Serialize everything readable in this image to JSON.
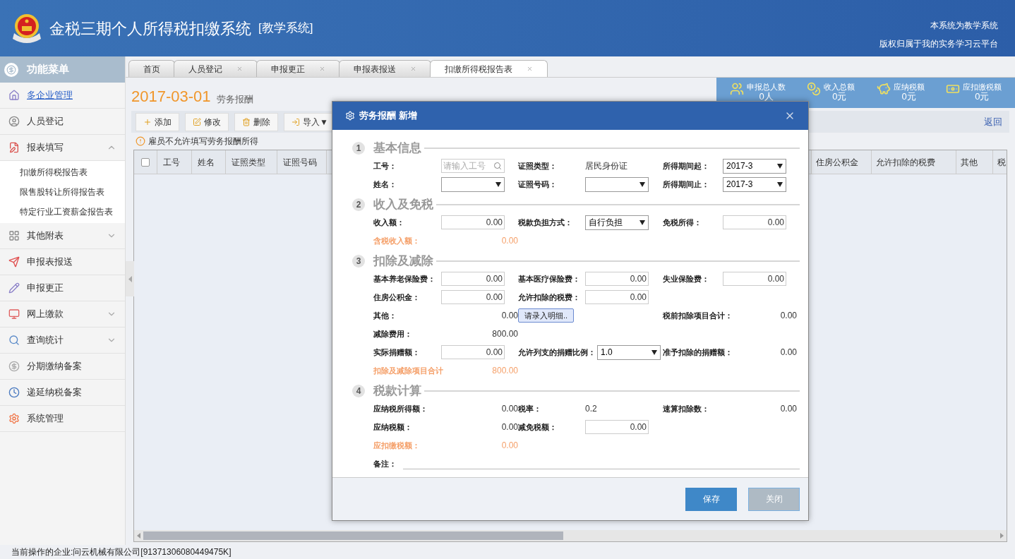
{
  "header": {
    "title": "金税三期个人所得税扣缴系统",
    "tag": "[教学系统]",
    "notes": [
      "本系统为教学系统",
      "版权归属于我的实务学习云平台"
    ]
  },
  "sidebar": {
    "title": "功能菜单",
    "items": [
      {
        "label": "多企业管理",
        "selected": true
      },
      {
        "label": "人员登记",
        "selected": false
      },
      {
        "label": "报表填写",
        "selected": false,
        "expanded": true,
        "children": [
          {
            "label": "扣缴所得税报告表"
          },
          {
            "label": "限售股转让所得报告表"
          },
          {
            "label": "特定行业工资薪金报告表"
          }
        ]
      },
      {
        "label": "其他附表",
        "selected": false,
        "expanded": false
      },
      {
        "label": "申报表报送",
        "selected": false
      },
      {
        "label": "申报更正",
        "selected": false
      },
      {
        "label": "网上缴款",
        "selected": false,
        "expanded": false
      },
      {
        "label": "查询统计",
        "selected": false,
        "expanded": false
      },
      {
        "label": "分期缴纳备案",
        "selected": false
      },
      {
        "label": "递延纳税备案",
        "selected": false
      },
      {
        "label": "系统管理",
        "selected": false
      }
    ]
  },
  "tabs": [
    {
      "label": "首页",
      "selected": false,
      "closable": false
    },
    {
      "label": "人员登记",
      "selected": false,
      "closable": true
    },
    {
      "label": "申报更正",
      "selected": false,
      "closable": true
    },
    {
      "label": "申报表报送",
      "selected": false,
      "closable": true
    },
    {
      "label": "扣缴所得税报告表",
      "selected": true,
      "closable": true
    }
  ],
  "page": {
    "date": "2017-03-01",
    "subtitle": "劳务报酬",
    "back_link": "返回",
    "notice": "雇员不允许填写劳务报酬所得"
  },
  "stats": [
    {
      "label": "申报总人数",
      "value": "0人"
    },
    {
      "label": "收入总额",
      "value": "0元"
    },
    {
      "label": "应纳税额",
      "value": "0元"
    },
    {
      "label": "应扣缴税额",
      "value": "0元"
    }
  ],
  "toolbar": [
    {
      "label": "添加"
    },
    {
      "label": "修改"
    },
    {
      "label": "删除"
    },
    {
      "label": "导入▼"
    }
  ],
  "table": {
    "select_all": {
      "checked": false
    },
    "columns_left": [
      "工号",
      "姓名",
      "证照类型",
      "证照号码"
    ],
    "columns_right": [
      "住房公积金",
      "允许扣除的税费",
      "其他",
      "税"
    ]
  },
  "dialog": {
    "title": "劳务报酬 新增",
    "sections": [
      {
        "number": "1",
        "title": "基本信息",
        "rows": [
          [
            {
              "label": "工号：",
              "kind": "search",
              "placeholder": "请输入工号"
            },
            {
              "label": "证照类型：",
              "kind": "text-left",
              "value": "居民身份证"
            },
            {
              "label": "所得期间起：",
              "kind": "select",
              "value": "2017-3"
            }
          ],
          [
            {
              "label": "姓名：",
              "kind": "select"
            },
            {
              "label": "证照号码：",
              "kind": "select"
            },
            {
              "label": "所得期间止：",
              "kind": "select",
              "value": "2017-3"
            }
          ]
        ]
      },
      {
        "number": "2",
        "title": "收入及免税",
        "rows": [
          [
            {
              "label": "收入额：",
              "kind": "input",
              "value": "0.00"
            },
            {
              "label": "税款负担方式：",
              "kind": "select",
              "value": "自行负担"
            },
            {
              "label": "免税所得：",
              "kind": "input",
              "value": "0.00"
            }
          ],
          [
            {
              "label": "含税收入额：",
              "kind": "text",
              "value": "0.00",
              "accent": true
            }
          ]
        ]
      },
      {
        "number": "3",
        "title": "扣除及减除",
        "rows": [
          [
            {
              "label": "基本养老保险费：",
              "kind": "input",
              "value": "0.00"
            },
            {
              "label": "基本医疗保险费：",
              "kind": "input",
              "value": "0.00"
            },
            {
              "label": "失业保险费：",
              "kind": "input",
              "value": "0.00"
            }
          ],
          [
            {
              "label": "住房公积金：",
              "kind": "input",
              "value": "0.00"
            },
            {
              "label": "允许扣除的税费：",
              "kind": "input",
              "value": "0.00"
            }
          ],
          [
            {
              "label": "其他：",
              "kind": "text",
              "value": "0.00"
            },
            {
              "kind": "button",
              "value": "请录入明细.."
            },
            {
              "label": "税前扣除项目合计：",
              "kind": "text",
              "value": "0.00"
            }
          ],
          [
            {
              "label": "减除费用：",
              "kind": "text",
              "value": "800.00"
            }
          ],
          [
            {
              "label": "实际捐赠额：",
              "kind": "input",
              "value": "0.00"
            },
            {
              "label": "允许列支的捐赠比例：",
              "kind": "select",
              "value": "1.0"
            },
            {
              "label": "准予扣除的捐赠额：",
              "kind": "text",
              "value": "0.00"
            }
          ],
          [
            {
              "label": "扣除及减除项目合计",
              "kind": "text",
              "value": "800.00",
              "accent": true
            }
          ]
        ]
      },
      {
        "number": "4",
        "title": "税款计算",
        "rows": [
          [
            {
              "label": "应纳税所得额：",
              "kind": "text",
              "value": "0.00"
            },
            {
              "label": "税率：",
              "kind": "text-left",
              "value": "0.2"
            },
            {
              "label": "速算扣除数：",
              "kind": "text",
              "value": "0.00"
            }
          ],
          [
            {
              "label": "应纳税额：",
              "kind": "text",
              "value": "0.00"
            },
            {
              "label": "减免税额：",
              "kind": "input",
              "value": "0.00"
            }
          ],
          [
            {
              "label": "应扣缴税额：",
              "kind": "text",
              "value": "0.00",
              "accent": true
            }
          ],
          [
            {
              "label": "备注：",
              "kind": "line"
            }
          ]
        ]
      }
    ],
    "buttons": [
      {
        "label": "保存",
        "kind": "primary"
      },
      {
        "label": "关闭",
        "kind": "secondary"
      }
    ]
  },
  "status_bar": "当前操作的企业:问云机械有限公司[91371306080449475K]"
}
